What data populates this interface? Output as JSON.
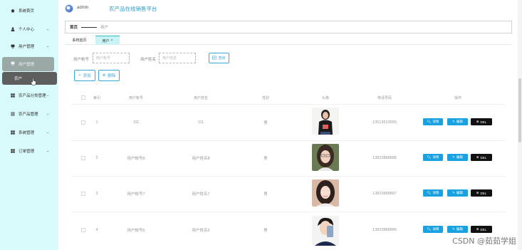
{
  "sidebar": {
    "items": [
      {
        "label": "系统首页",
        "icon": "home-icon",
        "chevron": false
      },
      {
        "label": "个人中心",
        "icon": "person-icon",
        "chevron": true
      },
      {
        "label": "用户管理",
        "icon": "user-manage-icon",
        "chevron": true
      },
      {
        "label": "用户管理",
        "icon": "user-manage-icon",
        "chevron": false,
        "active": true
      },
      {
        "label": "农产品分类管理",
        "icon": "grid-icon",
        "chevron": true
      },
      {
        "label": "农产品管理",
        "icon": "list-icon",
        "chevron": true
      },
      {
        "label": "系统管理",
        "icon": "grid-icon",
        "chevron": true
      },
      {
        "label": "订单管理",
        "icon": "grid-icon",
        "chevron": true
      }
    ],
    "sub_item": "农户"
  },
  "header": {
    "username": "admin",
    "title": "农产品在线销售平台"
  },
  "breadcrumb": {
    "home": "首页",
    "current": "用户"
  },
  "tabs": [
    {
      "label": "系统首页"
    },
    {
      "label": "用户",
      "close": "×"
    }
  ],
  "search": {
    "account_label": "用户帐号",
    "account_placeholder": "用户帐号",
    "name_label": "用户姓名",
    "name_placeholder": "用户姓名",
    "query_label": "查询"
  },
  "actions": {
    "add": "添加",
    "delete": "删除"
  },
  "table": {
    "headers": [
      "索引",
      "用户帐号",
      "用户姓名",
      "性别",
      "头像",
      "电话号码",
      "操作"
    ],
    "rows": [
      {
        "index": "1",
        "account": "111",
        "name": "111",
        "gender": "男",
        "phone": "13513513555"
      },
      {
        "index": "2",
        "account": "用户帐号8",
        "name": "用户姓名8",
        "gender": "男",
        "phone": "13823888888"
      },
      {
        "index": "3",
        "account": "用户帐号7",
        "name": "用户姓名7",
        "gender": "男",
        "phone": "13823888887"
      },
      {
        "index": "4",
        "account": "用户帐号6",
        "name": "用户姓名6",
        "gender": "男",
        "phone": "13823888886"
      }
    ],
    "btn_detail": "详情",
    "btn_edit": "编辑",
    "btn_del": "DEL"
  },
  "watermark": "CSDN @茹茹学姐",
  "colors": {
    "sidebar_bg": "#d8fafa",
    "accent": "#1aa2e0",
    "title": "#2a9cc8",
    "del_button": "#111111",
    "active_item": "#9aa8a6",
    "sub_item": "#5e5e5e"
  }
}
